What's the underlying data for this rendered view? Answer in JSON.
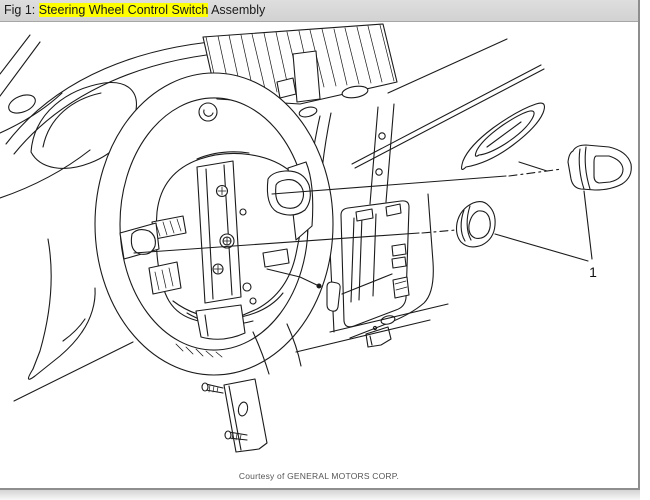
{
  "header": {
    "prefix": "Fig 1: ",
    "highlighted": "Steering Wheel Control Switch",
    "suffix": " Assembly"
  },
  "figure": {
    "title": "Steering Wheel Control Switch Assembly",
    "callout_label": "1",
    "callouts": [
      {
        "label": "1",
        "points_to": "steering wheel control switches (left and right)"
      }
    ],
    "credit": "Courtesy of GENERAL MOTORS CORP."
  },
  "colors": {
    "highlight": "#ffff00",
    "header_bar": "#d8d8d8",
    "line_art": "#1b1b1b",
    "canvas": "#ffffff",
    "border": "#8e8e8e",
    "credit_text": "#555555"
  }
}
